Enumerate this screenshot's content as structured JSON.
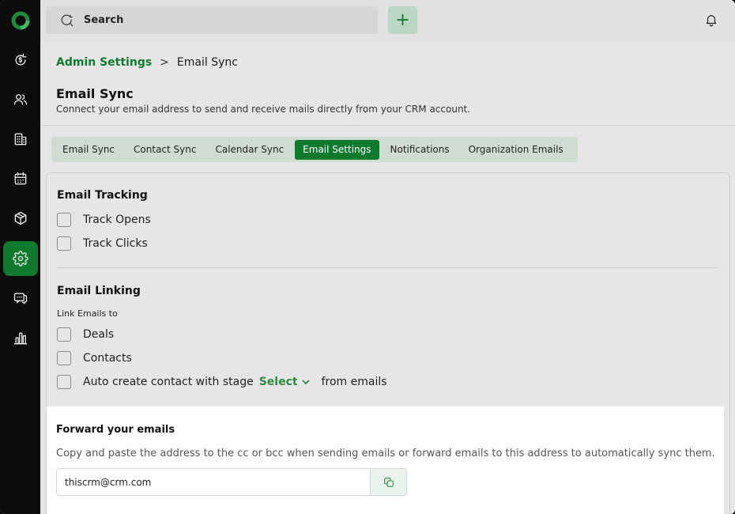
{
  "colors": {
    "accent": "#0f7a2e",
    "sidebar": "#0c0c0c"
  },
  "sidebar": {
    "items": [
      {
        "icon": "dollar-refresh-icon"
      },
      {
        "icon": "users-icon"
      },
      {
        "icon": "building-icon"
      },
      {
        "icon": "calendar-icon"
      },
      {
        "icon": "box-icon"
      },
      {
        "icon": "gear-icon",
        "active": true
      },
      {
        "icon": "chat-icon"
      },
      {
        "icon": "chart-icon"
      }
    ]
  },
  "topbar": {
    "search_placeholder": "Search",
    "add_label": "+"
  },
  "breadcrumb": {
    "parent": "Admin Settings",
    "separator": ">",
    "current": "Email Sync"
  },
  "page": {
    "title": "Email Sync",
    "description": "Connect your email address to send and receive mails directly from your CRM account."
  },
  "tabs": [
    {
      "label": "Email Sync"
    },
    {
      "label": "Contact Sync"
    },
    {
      "label": "Calendar Sync"
    },
    {
      "label": "Email Settings",
      "active": true
    },
    {
      "label": "Notifications"
    },
    {
      "label": "Organization Emails"
    }
  ],
  "tracking": {
    "title": "Email Tracking",
    "options": [
      "Track Opens",
      "Track Clicks"
    ]
  },
  "linking": {
    "title": "Email Linking",
    "sub_label": "Link Emails to",
    "options": [
      "Deals",
      "Contacts"
    ],
    "auto_create": {
      "prefix": "Auto create contact with stage",
      "select_label": "Select",
      "suffix": "from emails"
    }
  },
  "forward": {
    "title": "Forward your emails",
    "description": "Copy and paste the address to the cc or bcc when sending emails or forward emails to this address to automatically sync them.",
    "email": "thiscrm@crm.com"
  }
}
